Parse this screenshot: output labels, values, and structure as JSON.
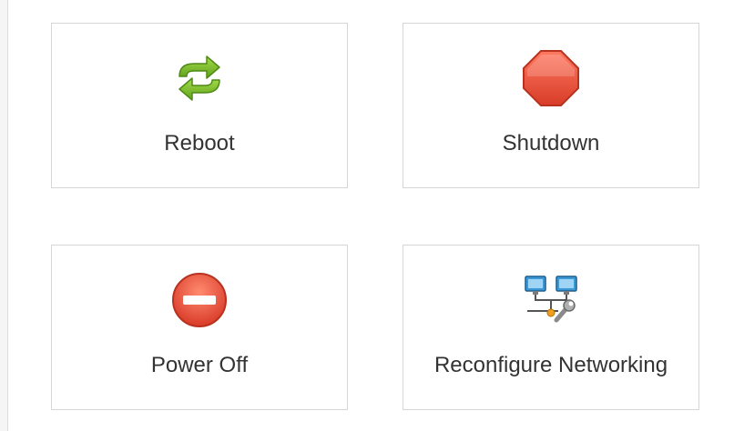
{
  "actions": [
    {
      "label": "Reboot",
      "icon": "reboot-icon"
    },
    {
      "label": "Shutdown",
      "icon": "stop-icon"
    },
    {
      "label": "Power Off",
      "icon": "power-off-icon"
    },
    {
      "label": "Reconfigure Networking",
      "icon": "network-configure-icon"
    }
  ],
  "colors": {
    "reboot_green": "#7cc02a",
    "stop_red": "#e8503a",
    "network_blue": "#3a9ad9"
  }
}
